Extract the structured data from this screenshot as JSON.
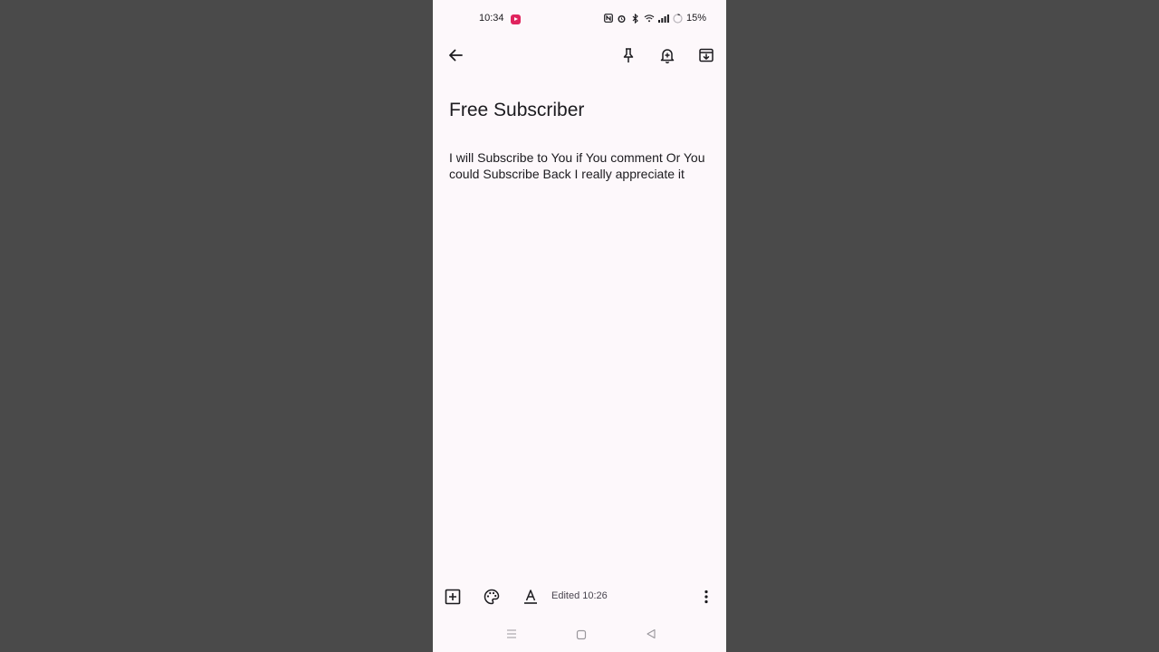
{
  "status_bar": {
    "time": "10:34",
    "battery": "15%"
  },
  "toolbar": {
    "back_icon": "arrow-left-icon",
    "pin_icon": "pin-icon",
    "reminder_icon": "bell-plus-icon",
    "archive_icon": "archive-icon"
  },
  "note": {
    "title": "Free Subscriber",
    "body": "I will Subscribe to You if You comment Or You could Subscribe Back I really appreciate it"
  },
  "bottom_bar": {
    "edited": "Edited 10:26"
  },
  "colors": {
    "page_background": "#4a4a4a",
    "note_background": "#fdf8fb",
    "text": "#1c1b1f",
    "status_app_badge": "#e0245e"
  }
}
